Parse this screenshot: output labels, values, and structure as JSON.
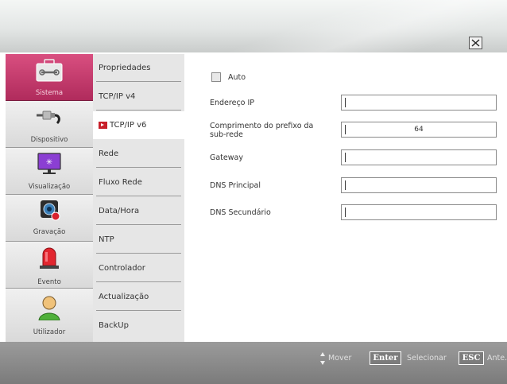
{
  "categories": [
    {
      "label": "Sistema",
      "icon": "toolbox-icon",
      "active": true
    },
    {
      "label": "Dispositivo",
      "icon": "cable-plug-icon",
      "active": false
    },
    {
      "label": "Visualização",
      "icon": "monitor-icon",
      "active": false
    },
    {
      "label": "Gravação",
      "icon": "camera-record-icon",
      "active": false
    },
    {
      "label": "Evento",
      "icon": "alarm-siren-icon",
      "active": false
    },
    {
      "label": "Utilizador",
      "icon": "user-icon",
      "active": false
    }
  ],
  "submenu": [
    {
      "label": "Propriedades"
    },
    {
      "label": "TCP/IP v4"
    },
    {
      "label": "TCP/IP v6",
      "active": true
    },
    {
      "label": "Rede"
    },
    {
      "label": "Fluxo Rede"
    },
    {
      "label": "Data/Hora"
    },
    {
      "label": "NTP"
    },
    {
      "label": "Controlador"
    },
    {
      "label": "Actualização"
    },
    {
      "label": "BackUp"
    }
  ],
  "form": {
    "auto_label": "Auto",
    "auto_checked": false,
    "fields": [
      {
        "label": "Endereço IP",
        "value": ""
      },
      {
        "label": "Comprimento do prefixo da sub-rede",
        "value": "64"
      },
      {
        "label": "Gateway",
        "value": ""
      },
      {
        "label": "DNS Principal",
        "value": ""
      },
      {
        "label": "DNS Secundário",
        "value": ""
      }
    ]
  },
  "footer": {
    "move_label": "Mover",
    "enter_key": "Enter",
    "select_label": "Selecionar",
    "esc_key": "ESC",
    "back_label": "Ante."
  },
  "colors": {
    "active_category": "#c23a6b",
    "active_arrow": "#c8202a"
  }
}
